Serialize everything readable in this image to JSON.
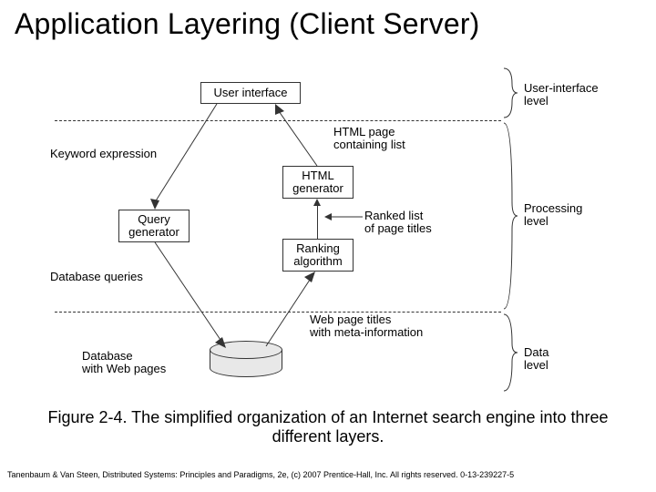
{
  "title": "Application Layering (Client Server)",
  "boxes": {
    "ui": "User interface",
    "html_gen": "HTML\ngenerator",
    "query_gen": "Query\ngenerator",
    "ranking": "Ranking\nalgorithm"
  },
  "labels": {
    "keyword": "Keyword expression",
    "html_page": "HTML page\ncontaining list",
    "ranked_list": "Ranked list\nof page titles",
    "db_queries": "Database queries",
    "web_titles": "Web page titles\nwith meta-information",
    "database": "Database\nwith Web pages"
  },
  "levels": {
    "ui": "User-interface\nlevel",
    "proc": "Processing\nlevel",
    "data": "Data level"
  },
  "caption": "Figure 2-4. The simplified organization of an Internet search engine into three different layers.",
  "reference": "Tanenbaum & Van Steen, Distributed Systems: Principles and Paradigms, 2e, (c) 2007 Prentice-Hall, Inc. All rights reserved. 0-13-239227-5"
}
